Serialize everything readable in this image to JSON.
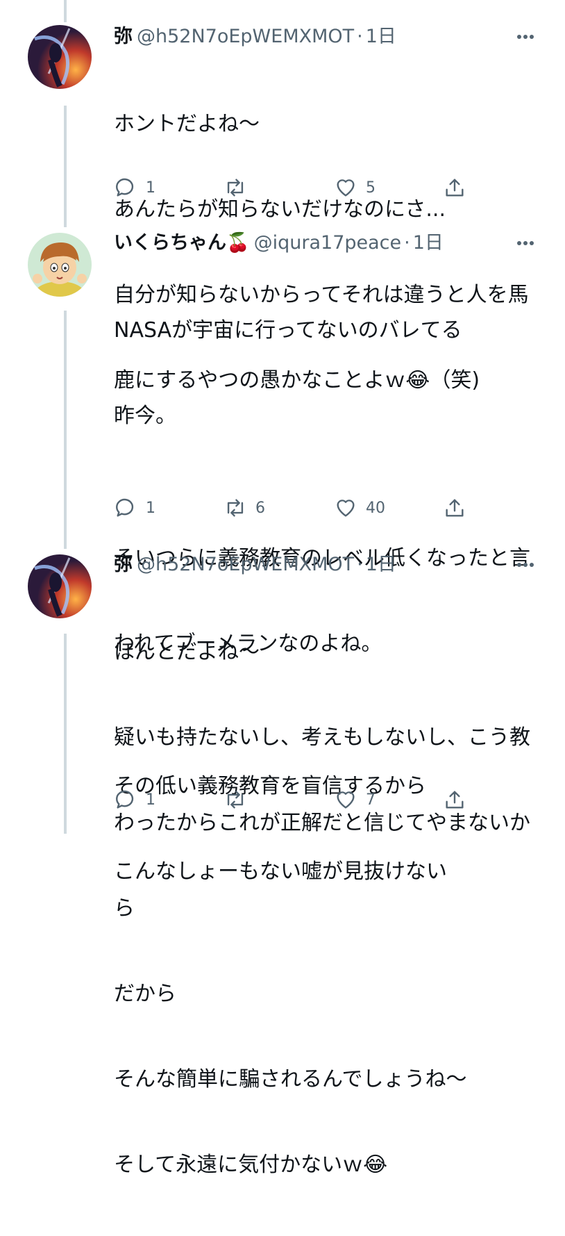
{
  "tweets": [
    {
      "name": "弥",
      "handle": "@h52N7oEpWEMXMOT",
      "dot": "·",
      "time": "1日",
      "lines": [
        "ホントだよね〜",
        "あんたらが知らないだけなのにさ...",
        "自分が知らないからってそれは違うと人を馬",
        "鹿にするやつの愚かなことよｗ😂（笑)"
      ],
      "replies": "1",
      "retweets": "",
      "likes": "5"
    },
    {
      "name": "いくらちゃん🍒",
      "handle": "@iqura17peace",
      "dot": "·",
      "time": "1日",
      "lines": [
        "NASAが宇宙に行ってないのバレてる",
        "昨今。",
        "",
        "そいつらに義務教育のレベル低くなったと言",
        "われてブーメランなのよね。",
        "",
        "その低い義務教育を盲信するから",
        "こんなしょーもない嘘が見抜けない"
      ],
      "replies": "1",
      "retweets": "6",
      "likes": "40"
    },
    {
      "name": "弥",
      "handle": "@h52N7oEpWEMXMOT",
      "dot": "·",
      "time": "1日",
      "lines": [
        "ほんとだよね〜",
        "疑いも持たないし、考えもしないし、こう教",
        "わったからこれが正解だと信じてやまないか",
        "ら",
        "だから",
        "そんな簡単に騙されるんでしょうね〜",
        "そして永遠に気付かないｗ😂"
      ],
      "replies": "1",
      "retweets": "",
      "likes": "7"
    }
  ],
  "icons": {
    "reply": "reply-icon",
    "retweet": "retweet-icon",
    "like": "heart-icon",
    "share": "share-icon",
    "more": "more-icon"
  },
  "colors": {
    "text": "#0f1419",
    "secondary": "#536471",
    "thread_line": "#cfd9de"
  }
}
